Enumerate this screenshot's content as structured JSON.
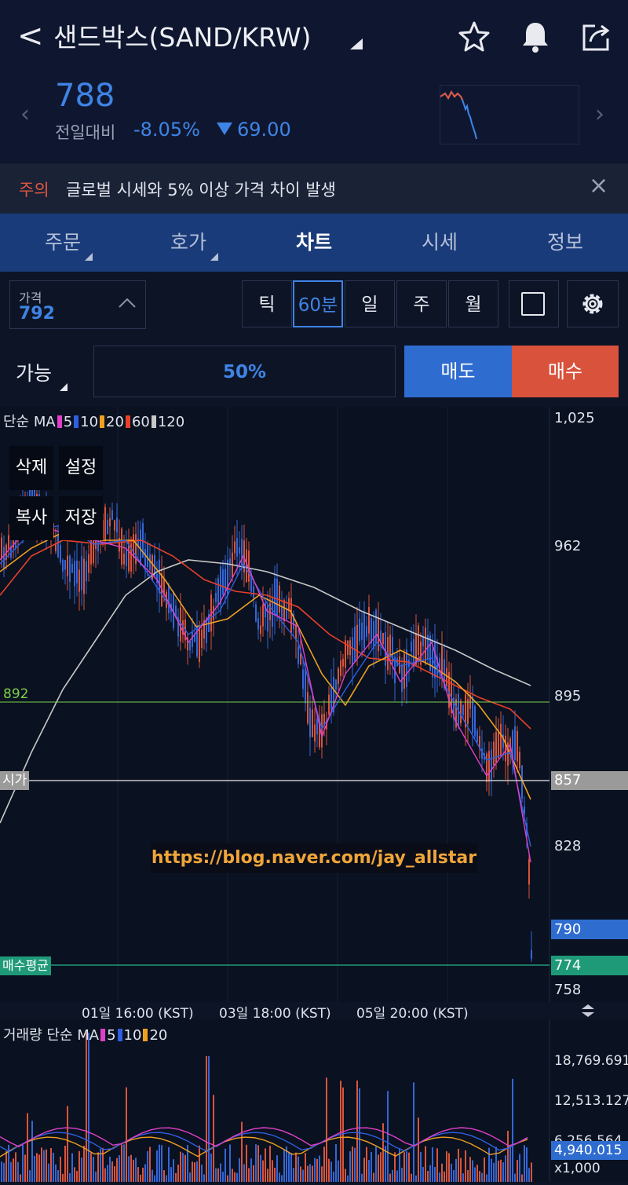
{
  "header": {
    "back_glyph": "<",
    "title": "샌드박스(SAND/KRW)",
    "icons": [
      "star-icon",
      "bell-icon",
      "share-icon"
    ]
  },
  "ticker": {
    "price": "788",
    "prev_label": "전일대비",
    "change_pct": "-8.05%",
    "change_amount": "69.00",
    "down_color": "#3f84e5"
  },
  "notice": {
    "label": "주의",
    "text": "글로벌 시세와 5% 이상 가격 차이 발생",
    "close_glyph": "×"
  },
  "tabs": [
    {
      "label": "주문",
      "active": false
    },
    {
      "label": "호가",
      "active": false
    },
    {
      "label": "차트",
      "active": true
    },
    {
      "label": "시세",
      "active": false
    },
    {
      "label": "정보",
      "active": false
    }
  ],
  "toolbar": {
    "price_label": "가격",
    "price_value": "792",
    "intervals": [
      {
        "label": "틱",
        "active": false
      },
      {
        "label": "60분",
        "active": true
      },
      {
        "label": "일",
        "active": false
      },
      {
        "label": "주",
        "active": false
      },
      {
        "label": "월",
        "active": false
      }
    ]
  },
  "order": {
    "avail_label": "가능",
    "percent": "50%",
    "sell_label": "매도",
    "buy_label": "매수",
    "sell_color": "#2f6cd0",
    "buy_color": "#d9523c"
  },
  "chart": {
    "legend_prefix": "단순 MA",
    "ma": [
      {
        "period": "5",
        "color": "#e040c8"
      },
      {
        "period": "10",
        "color": "#2f5fe0"
      },
      {
        "period": "20",
        "color": "#f0a020"
      },
      {
        "period": "60",
        "color": "#e8402a"
      },
      {
        "period": "120",
        "color": "#c8c8c8"
      }
    ],
    "context_menu": [
      "삭제",
      "설정",
      "복사",
      "저장"
    ],
    "y_axis_labels": [
      "1,025",
      "962",
      "895",
      "857",
      "828",
      "790",
      "774",
      "758"
    ],
    "hline_labels": {
      "green": "892",
      "open": "시가",
      "avg": "매수평균"
    },
    "watermark": "https://blog.naver.com/jay_allstar",
    "time_labels": [
      "01일 16:00 (KST)",
      "03일 18:00 (KST)",
      "05일 20:00 (KST)"
    ]
  },
  "volume": {
    "legend_prefix": "거래량 단순 MA",
    "ma": [
      {
        "period": "5",
        "color": "#e040c8"
      },
      {
        "period": "10",
        "color": "#2f5fe0"
      },
      {
        "period": "20",
        "color": "#f0a020"
      }
    ],
    "axis_labels": [
      "18,769.691",
      "12,513.127",
      "6,256.564",
      "4,940.015"
    ],
    "unit_label": "x1,000"
  }
}
